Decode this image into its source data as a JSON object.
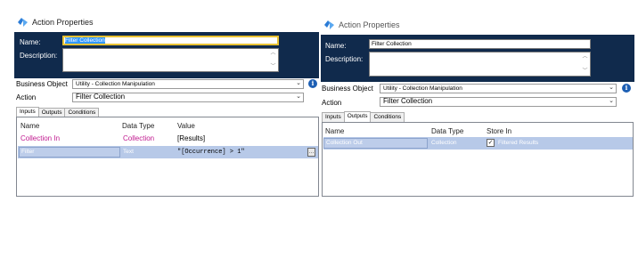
{
  "left": {
    "title": "Action Properties",
    "name_label": "Name:",
    "name_value": "Filter Collection",
    "description_label": "Description:",
    "business_object_label": "Business Object",
    "business_object_value": "Utility - Collection Manipulation",
    "action_label": "Action",
    "action_value": "Filter Collection",
    "tabs": [
      "Inputs",
      "Outputs",
      "Conditions"
    ],
    "active_tab": "Inputs",
    "columns": [
      "Name",
      "Data Type",
      "Value"
    ],
    "rows": [
      {
        "name": "Collection In",
        "type": "Collection",
        "value": "[Results]"
      },
      {
        "name": "Filter",
        "type": "Text",
        "value": "\"[Occurrence] > 1\""
      }
    ],
    "edit_glyph": "…"
  },
  "right": {
    "title": "Action Properties",
    "name_label": "Name:",
    "name_value": "Filter Collection",
    "description_label": "Description:",
    "business_object_label": "Business Object",
    "business_object_value": "Utility - Collection Manipulation",
    "action_label": "Action",
    "action_value": "Filter Collection",
    "tabs": [
      "Inputs",
      "Outputs",
      "Conditions"
    ],
    "active_tab": "Outputs",
    "columns": [
      "Name",
      "Data Type",
      "Store In"
    ],
    "rows": [
      {
        "name": "Collection Out",
        "type": "Collection",
        "store_in": "Filtered Results"
      }
    ]
  },
  "icons": {
    "app": "blue-prism-icon",
    "info": "info-icon",
    "dropdown": "chevron-down-icon",
    "scroll_up": "scroll-up-icon",
    "scroll_down": "scroll-down-icon",
    "edit": "ellipsis-button-icon",
    "store_in": "checkbox-icon"
  },
  "colors": {
    "header_bg": "#102a4c",
    "focus_border": "#e9c233",
    "selection": "#3399ff",
    "selected_row": "#b7c9e8",
    "collection_text": "#c0198f",
    "info": "#1d5fb4"
  },
  "glyphs": {
    "up": "︿",
    "down": "﹀",
    "chevron": "⌄",
    "info": "i",
    "check": "✓"
  }
}
